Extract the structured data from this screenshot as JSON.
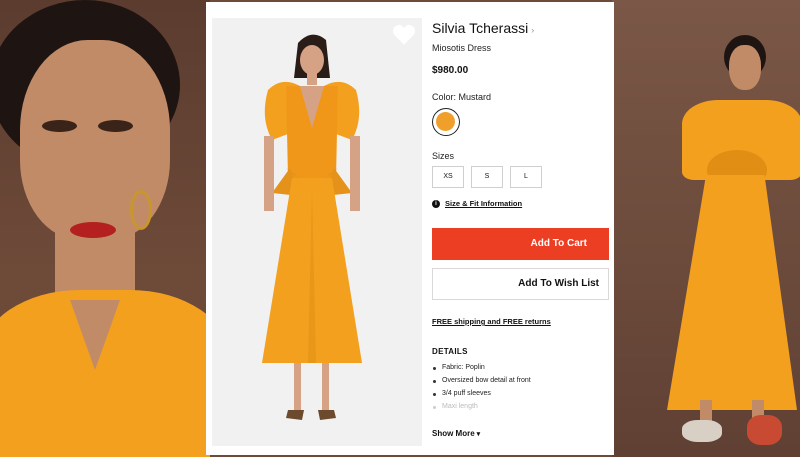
{
  "product": {
    "brand": "Silvia Tcherassi",
    "brand_caret": "›",
    "name": "Miosotis Dress",
    "price": "$980.00",
    "color_label": "Color: Mustard",
    "color_hex": "#f0a02a",
    "sizes_label": "Sizes",
    "sizes": [
      "XS",
      "S",
      "L"
    ],
    "fit_link": "Size & Fit Information",
    "add_to_cart": "Add To Cart",
    "add_to_wishlist": "Add To Wish List",
    "shipping": "FREE shipping and FREE returns",
    "details_title": "DETAILS",
    "details": [
      "Fabric: Poplin",
      "Oversized bow detail at front",
      "3/4 puff sleeves",
      "Maxi length"
    ],
    "show_more": "Show More"
  },
  "icons": {
    "heart": "heart-icon",
    "info": "info-icon",
    "chevron": "chevron-down-icon"
  },
  "colors": {
    "accent": "#ec3e23",
    "dress": "#f3a01f"
  }
}
